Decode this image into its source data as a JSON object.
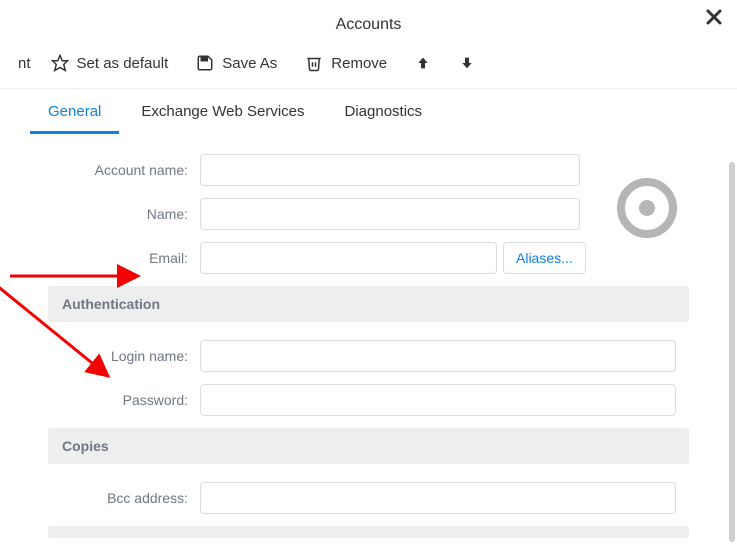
{
  "dialog": {
    "title": "Accounts"
  },
  "toolbar": {
    "cut_text": "nt",
    "set_default_label": "Set as default",
    "save_as_label": "Save As",
    "remove_label": "Remove"
  },
  "tabs": {
    "general": "General",
    "ews": "Exchange Web Services",
    "diagnostics": "Diagnostics"
  },
  "fields": {
    "account_name_label": "Account name:",
    "name_label": "Name:",
    "email_label": "Email:",
    "aliases_label": "Aliases...",
    "login_name_label": "Login name:",
    "password_label": "Password:",
    "bcc_label": "Bcc address:"
  },
  "sections": {
    "authentication": "Authentication",
    "copies": "Copies"
  },
  "values": {
    "account_name": "",
    "name": "",
    "email": "",
    "login_name": "",
    "password": "",
    "bcc": ""
  }
}
